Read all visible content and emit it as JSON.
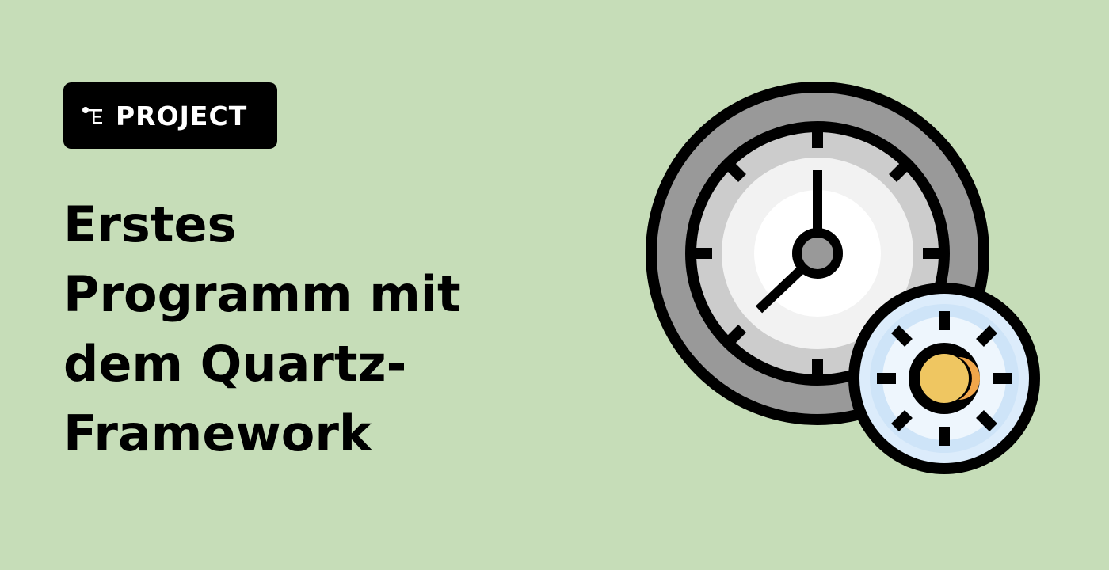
{
  "badge": {
    "label": "PROJECT",
    "icon": "project-tree-icon"
  },
  "title": {
    "lines": [
      "Erstes",
      "Programm mit",
      "dem Quartz-",
      "Framework"
    ]
  },
  "illustration": {
    "icons": [
      "clock-icon",
      "gear-icon"
    ]
  },
  "colors": {
    "background": "#c6ddb8",
    "badge": "#000000",
    "clock_outer": "#999999",
    "clock_inner": "#cccccc",
    "clock_face": "#f2f2f2",
    "gear_body": "#dcecfb",
    "gear_center": "#efc661"
  }
}
